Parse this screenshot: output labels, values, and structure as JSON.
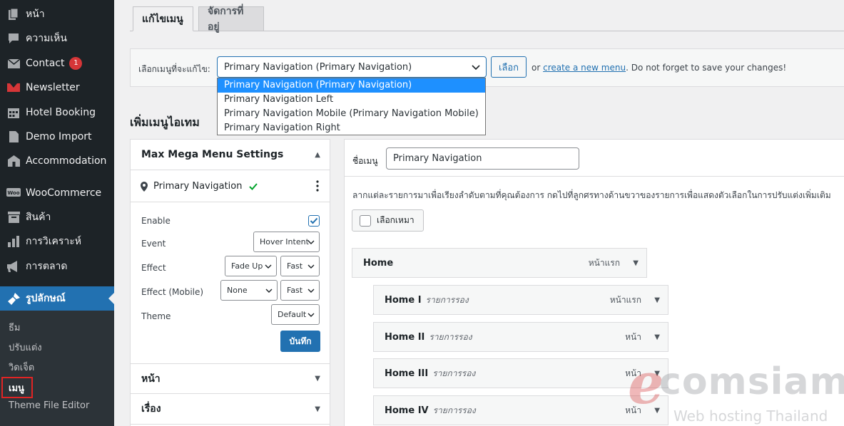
{
  "sidebar": {
    "items": [
      {
        "label": "หน้า",
        "icon": "page-icon"
      },
      {
        "label": "ความเห็น",
        "icon": "comment-icon"
      },
      {
        "label": "Contact",
        "icon": "mail-icon",
        "badge": "1"
      },
      {
        "label": "Newsletter",
        "icon": "newsletter-icon"
      },
      {
        "label": "Hotel Booking",
        "icon": "calendar-icon"
      },
      {
        "label": "Demo Import",
        "icon": "document-icon"
      },
      {
        "label": "Accommodation",
        "icon": "building-icon"
      },
      {
        "label": "WooCommerce",
        "icon": "woo-icon"
      },
      {
        "label": "สินค้า",
        "icon": "archive-icon"
      },
      {
        "label": "การวิเคราะห์",
        "icon": "chart-icon"
      },
      {
        "label": "การตลาด",
        "icon": "megaphone-icon"
      },
      {
        "label": "รูปลักษณ์",
        "icon": "brush-icon"
      }
    ],
    "submenu": [
      "ธีม",
      "ปรับแต่ง",
      "วิดเจ็ต",
      "เมนู",
      "Theme File Editor"
    ]
  },
  "tabs": [
    "แก้ไขเมนู",
    "จัดการที่อยู่"
  ],
  "manage": {
    "label": "เลือกเมนูที่จะแก้ไข:",
    "selected": "Primary Navigation (Primary Navigation)",
    "select_button": "เลือก",
    "note_prefix": "or ",
    "note_link": "create a new menu",
    "note_suffix": ". Do not forget to save your changes!",
    "options": [
      "Primary Navigation (Primary Navigation)",
      "Primary Navigation Left",
      "Primary Navigation Mobile (Primary Navigation Mobile)",
      "Primary Navigation Right"
    ]
  },
  "section_title": "เพิ่มเมนูไอเทม",
  "megamenu": {
    "title": "Max Mega Menu Settings",
    "nav_name": "Primary Navigation",
    "rows": {
      "enable": "Enable",
      "event": "Event",
      "effect": "Effect",
      "effect_mobile": "Effect (Mobile)",
      "theme": "Theme"
    },
    "event_value": "Hover Intent",
    "effect_value": "Fade Up",
    "effect_speed": "Fast",
    "effect_mobile_value": "None",
    "effect_mobile_speed": "Fast",
    "theme_value": "Default",
    "save_label": "บันทึก",
    "enabled": true
  },
  "accordion": [
    "หน้า",
    "เรื่อง"
  ],
  "structure": {
    "name_label": "ชื่อเมนู",
    "name_value": "Primary Navigation",
    "instructions": "ลากแต่ละรายการมาเพื่อเรียงลำดับตามที่คุณต้องการ กดไปที่ลูกศรทางด้านขวาของรายการเพื่อแสดงตัวเลือกในการปรับแต่งเพิ่มเติม",
    "select_all": "เลือกเหมา",
    "items": [
      {
        "title": "Home",
        "sub": "",
        "type": "หน้าแรก"
      },
      {
        "title": "Home I",
        "sub": "รายการรอง",
        "type": "หน้าแรก"
      },
      {
        "title": "Home II",
        "sub": "รายการรอง",
        "type": "หน้า"
      },
      {
        "title": "Home III",
        "sub": "รายการรอง",
        "type": "หน้า"
      },
      {
        "title": "Home IV",
        "sub": "รายการรอง",
        "type": "หน้า"
      }
    ]
  },
  "watermark": {
    "letter": "e",
    "text": "comsiam",
    "sub": "Web hosting Thailand"
  },
  "colors": {
    "sidebar": "#1d2327",
    "accent": "#2271b1",
    "badge": "#d63638",
    "highlight": "#e02424"
  }
}
